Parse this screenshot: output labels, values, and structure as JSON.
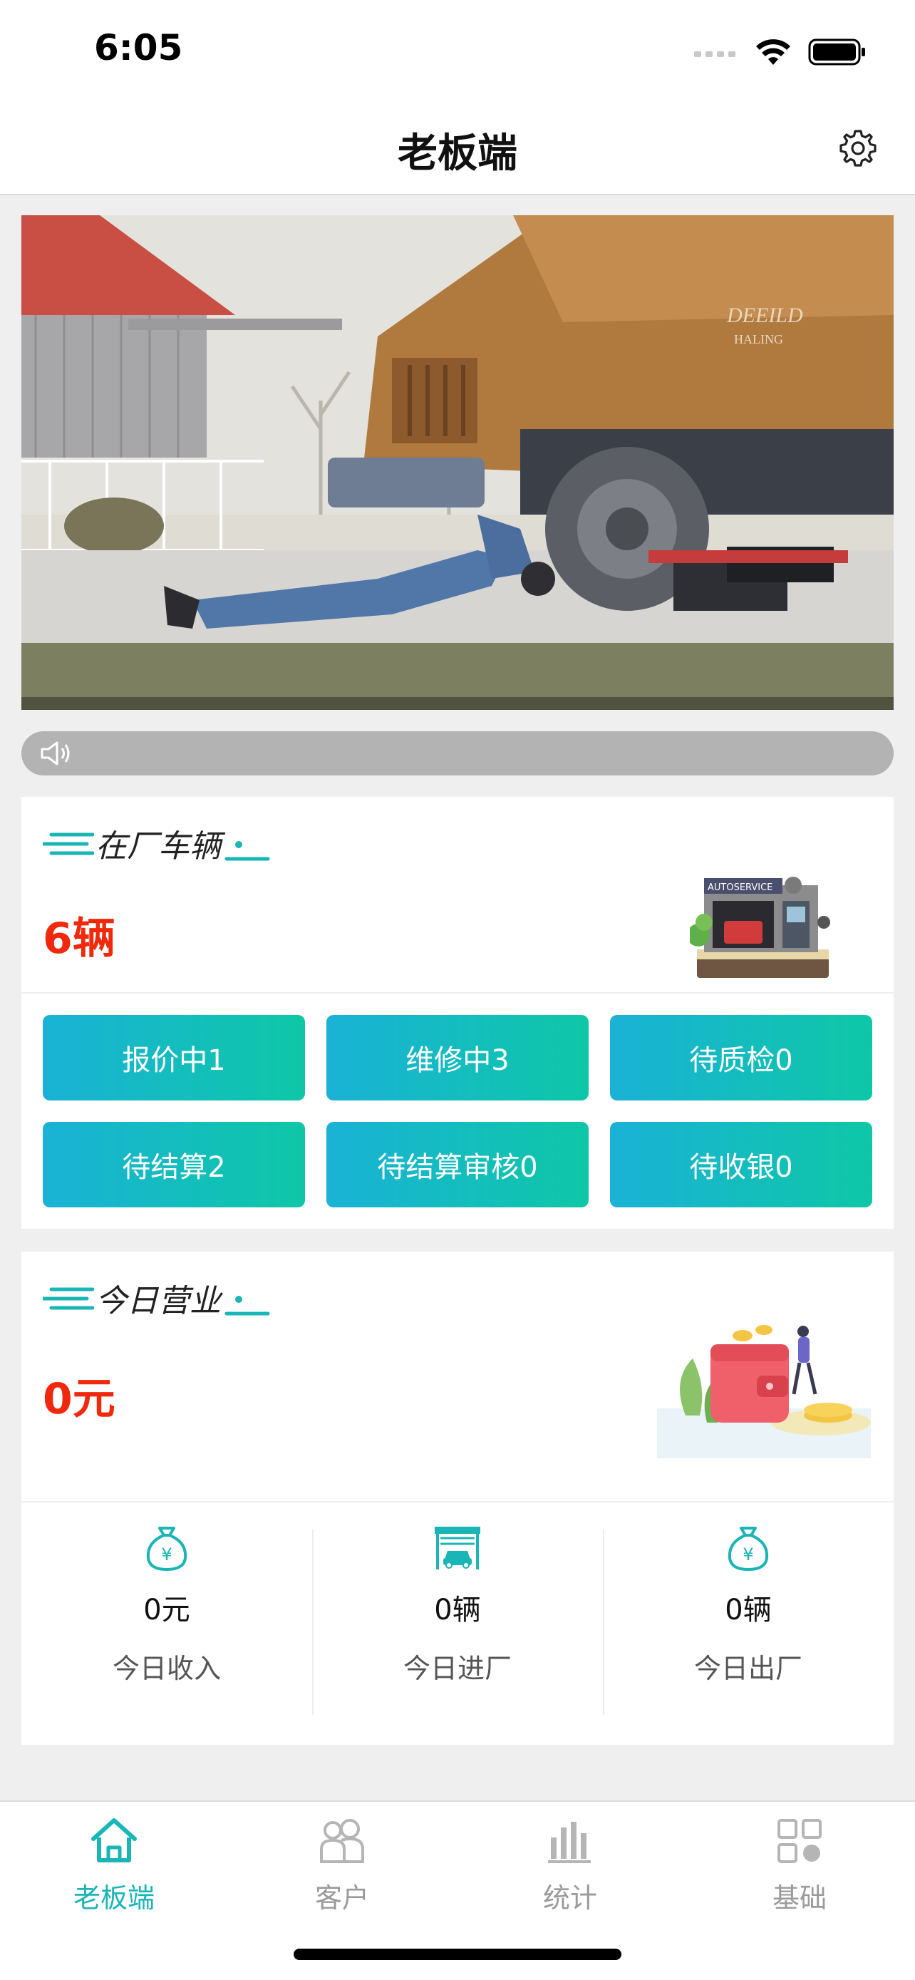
{
  "status_bar": {
    "time": "6:05"
  },
  "nav": {
    "title": "老板端"
  },
  "notice": {
    "text": ""
  },
  "vehicles": {
    "title": "在厂车辆",
    "total": "6辆",
    "statuses": [
      {
        "label": "报价中1"
      },
      {
        "label": "维修中3"
      },
      {
        "label": "待质检0"
      },
      {
        "label": "待结算2"
      },
      {
        "label": "待结算审核0"
      },
      {
        "label": "待收银0"
      }
    ]
  },
  "business": {
    "title": "今日营业",
    "total": "0元",
    "stats": [
      {
        "value": "0元",
        "label": "今日收入",
        "icon": "money-bag-icon"
      },
      {
        "value": "0辆",
        "label": "今日进厂",
        "icon": "garage-in-icon"
      },
      {
        "value": "0辆",
        "label": "今日出厂",
        "icon": "money-bag-icon"
      }
    ]
  },
  "tabs": [
    {
      "label": "老板端",
      "icon": "home-icon",
      "active": true
    },
    {
      "label": "客户",
      "icon": "customers-icon",
      "active": false
    },
    {
      "label": "统计",
      "icon": "chart-icon",
      "active": false
    },
    {
      "label": "基础",
      "icon": "grid-icon",
      "active": false
    }
  ],
  "colors": {
    "accent": "#1ab5b6",
    "gradient_start": "#1ab2d6",
    "gradient_end": "#0ec7a6",
    "value_red": "#f0290d",
    "tab_inactive": "#9a9a9a"
  }
}
